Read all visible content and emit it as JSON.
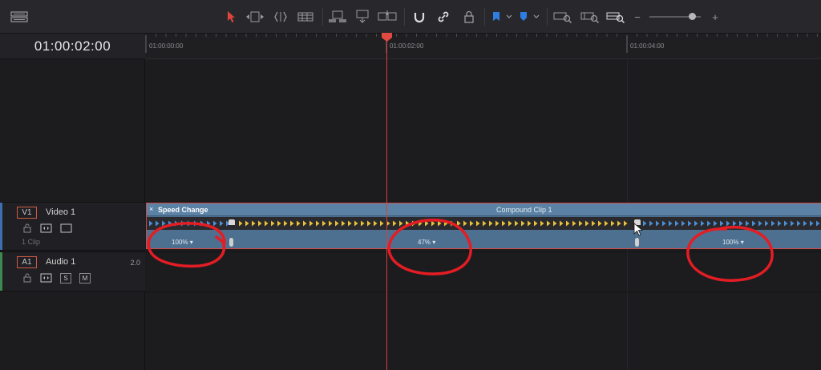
{
  "toolbar": {
    "icons": [
      "layout-icon",
      "selection-arrow-icon",
      "trim-edit-icon",
      "dynamic-trim-icon",
      "blade-icon",
      "insert-clip-icon",
      "overwrite-clip-icon",
      "replace-clip-icon",
      "snapping-icon",
      "linked-selection-icon",
      "position-lock-icon",
      "flag-icon",
      "marker-icon",
      "zoom-full-icon",
      "zoom-detail-icon",
      "zoom-custom-icon"
    ],
    "zoom_out": "−",
    "zoom_in": "+",
    "accent_color": "#e0453c"
  },
  "timecode": "01:00:02:00",
  "ruler": {
    "labels": [
      "01:00:00:00",
      "01:00:02:00",
      "01:00:04:00"
    ]
  },
  "tracks": {
    "v1": {
      "tag": "V1",
      "name": "Video 1",
      "sub": "1 Clip",
      "color": "#3d6fae"
    },
    "a1": {
      "tag": "A1",
      "name": "Audio 1",
      "meta": "2.0",
      "solo": "S",
      "mute": "M",
      "color": "#3b8a4e"
    }
  },
  "clip": {
    "close": "×",
    "badge": "Speed Change",
    "name": "Compound Clip 1",
    "speeds": [
      "100%",
      "47%",
      "100%"
    ],
    "dropdown": "▾"
  }
}
